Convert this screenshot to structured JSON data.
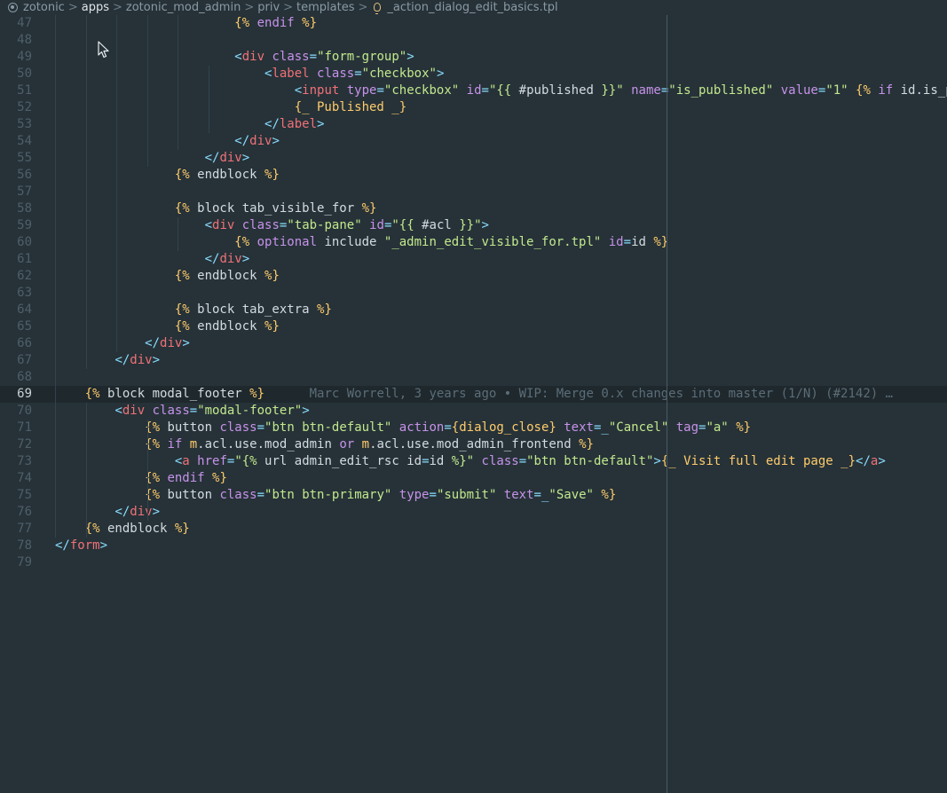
{
  "breadcrumb": {
    "items": [
      "zotonic",
      "apps",
      "zotonic_mod_admin",
      "priv",
      "templates",
      "_action_dialog_edit_basics.tpl"
    ],
    "active_index": 1,
    "separator": ">"
  },
  "editor": {
    "current_line": 69,
    "lines": [
      {
        "n": "47",
        "tokens": [
          [
            "                        ",
            "plain"
          ],
          [
            "{%",
            "delim"
          ],
          [
            " endif ",
            "kw"
          ],
          [
            "%}",
            "delim"
          ]
        ]
      },
      {
        "n": "48",
        "tokens": []
      },
      {
        "n": "49",
        "tokens": [
          [
            "                        ",
            "plain"
          ],
          [
            "<",
            "punc"
          ],
          [
            "div",
            "tag"
          ],
          [
            " ",
            "plain"
          ],
          [
            "class",
            "attr"
          ],
          [
            "=",
            "punc"
          ],
          [
            "\"form-group\"",
            "str"
          ],
          [
            ">",
            "punc"
          ]
        ]
      },
      {
        "n": "50",
        "tokens": [
          [
            "                            ",
            "plain"
          ],
          [
            "<",
            "punc"
          ],
          [
            "label",
            "tag"
          ],
          [
            " ",
            "plain"
          ],
          [
            "class",
            "attr"
          ],
          [
            "=",
            "punc"
          ],
          [
            "\"checkbox\"",
            "str"
          ],
          [
            ">",
            "punc"
          ]
        ]
      },
      {
        "n": "51",
        "tokens": [
          [
            "                                ",
            "plain"
          ],
          [
            "<",
            "punc"
          ],
          [
            "input",
            "tag"
          ],
          [
            " ",
            "plain"
          ],
          [
            "type",
            "attr"
          ],
          [
            "=",
            "punc"
          ],
          [
            "\"checkbox\"",
            "str"
          ],
          [
            " ",
            "plain"
          ],
          [
            "id",
            "attr"
          ],
          [
            "=",
            "punc"
          ],
          [
            "\"{{ ",
            "str"
          ],
          [
            "#published",
            "plain"
          ],
          [
            " }}\"",
            "str"
          ],
          [
            " ",
            "plain"
          ],
          [
            "name",
            "attr"
          ],
          [
            "=",
            "punc"
          ],
          [
            "\"is_published\"",
            "str"
          ],
          [
            " ",
            "plain"
          ],
          [
            "value",
            "attr"
          ],
          [
            "=",
            "punc"
          ],
          [
            "\"1\"",
            "str"
          ],
          [
            " ",
            "plain"
          ],
          [
            "{%",
            "delim"
          ],
          [
            " if ",
            "kw"
          ],
          [
            "id.is_pu",
            "plain"
          ]
        ]
      },
      {
        "n": "52",
        "tokens": [
          [
            "                                ",
            "plain"
          ],
          [
            "{_ Published _}",
            "trans"
          ]
        ]
      },
      {
        "n": "53",
        "tokens": [
          [
            "                            ",
            "plain"
          ],
          [
            "</",
            "punc"
          ],
          [
            "label",
            "tag"
          ],
          [
            ">",
            "punc"
          ]
        ]
      },
      {
        "n": "54",
        "tokens": [
          [
            "                        ",
            "plain"
          ],
          [
            "</",
            "punc"
          ],
          [
            "div",
            "tag"
          ],
          [
            ">",
            "punc"
          ]
        ]
      },
      {
        "n": "55",
        "tokens": [
          [
            "                    ",
            "plain"
          ],
          [
            "</",
            "punc"
          ],
          [
            "div",
            "tag"
          ],
          [
            ">",
            "punc"
          ]
        ]
      },
      {
        "n": "56",
        "tokens": [
          [
            "                ",
            "plain"
          ],
          [
            "{%",
            "delim"
          ],
          [
            " endblock ",
            "plain"
          ],
          [
            "%}",
            "delim"
          ]
        ]
      },
      {
        "n": "57",
        "tokens": []
      },
      {
        "n": "58",
        "tokens": [
          [
            "                ",
            "plain"
          ],
          [
            "{%",
            "delim"
          ],
          [
            " block tab_visible_for ",
            "plain"
          ],
          [
            "%}",
            "delim"
          ]
        ]
      },
      {
        "n": "59",
        "tokens": [
          [
            "                    ",
            "plain"
          ],
          [
            "<",
            "punc"
          ],
          [
            "div",
            "tag"
          ],
          [
            " ",
            "plain"
          ],
          [
            "class",
            "attr"
          ],
          [
            "=",
            "punc"
          ],
          [
            "\"tab-pane\"",
            "str"
          ],
          [
            " ",
            "plain"
          ],
          [
            "id",
            "attr"
          ],
          [
            "=",
            "punc"
          ],
          [
            "\"{{ ",
            "str"
          ],
          [
            "#acl",
            "plain"
          ],
          [
            " }}\"",
            "str"
          ],
          [
            ">",
            "punc"
          ]
        ]
      },
      {
        "n": "60",
        "tokens": [
          [
            "                        ",
            "plain"
          ],
          [
            "{%",
            "delim"
          ],
          [
            " optional ",
            "kw"
          ],
          [
            "include ",
            "plain"
          ],
          [
            "\"_admin_edit_visible_for.tpl\"",
            "str"
          ],
          [
            " id",
            "attr"
          ],
          [
            "=",
            "punc"
          ],
          [
            "id ",
            "plain"
          ],
          [
            "%}",
            "delim"
          ]
        ]
      },
      {
        "n": "61",
        "tokens": [
          [
            "                    ",
            "plain"
          ],
          [
            "</",
            "punc"
          ],
          [
            "div",
            "tag"
          ],
          [
            ">",
            "punc"
          ]
        ]
      },
      {
        "n": "62",
        "tokens": [
          [
            "                ",
            "plain"
          ],
          [
            "{%",
            "delim"
          ],
          [
            " endblock ",
            "plain"
          ],
          [
            "%}",
            "delim"
          ]
        ]
      },
      {
        "n": "63",
        "tokens": []
      },
      {
        "n": "64",
        "tokens": [
          [
            "                ",
            "plain"
          ],
          [
            "{%",
            "delim"
          ],
          [
            " block tab_extra ",
            "plain"
          ],
          [
            "%}",
            "delim"
          ]
        ]
      },
      {
        "n": "65",
        "tokens": [
          [
            "                ",
            "plain"
          ],
          [
            "{%",
            "delim"
          ],
          [
            " endblock ",
            "plain"
          ],
          [
            "%}",
            "delim"
          ]
        ]
      },
      {
        "n": "66",
        "tokens": [
          [
            "            ",
            "plain"
          ],
          [
            "</",
            "punc"
          ],
          [
            "div",
            "tag"
          ],
          [
            ">",
            "punc"
          ]
        ]
      },
      {
        "n": "67",
        "tokens": [
          [
            "        ",
            "plain"
          ],
          [
            "</",
            "punc"
          ],
          [
            "div",
            "tag"
          ],
          [
            ">",
            "punc"
          ]
        ]
      },
      {
        "n": "68",
        "tokens": []
      },
      {
        "n": "69",
        "tokens": [
          [
            "    ",
            "plain"
          ],
          [
            "{%",
            "delim"
          ],
          [
            " block modal_footer ",
            "plain"
          ],
          [
            "%}",
            "delim"
          ],
          [
            "      ",
            "plain"
          ],
          [
            "Marc Worrell, 3 years ago • WIP: Merge 0.x changes into master (1/N) (#2142) …",
            "blame"
          ]
        ]
      },
      {
        "n": "70",
        "tokens": [
          [
            "        ",
            "plain"
          ],
          [
            "<",
            "punc"
          ],
          [
            "div",
            "tag"
          ],
          [
            " ",
            "plain"
          ],
          [
            "class",
            "attr"
          ],
          [
            "=",
            "punc"
          ],
          [
            "\"modal-footer\"",
            "str"
          ],
          [
            ">",
            "punc"
          ]
        ]
      },
      {
        "n": "71",
        "tokens": [
          [
            "            ",
            "plain"
          ],
          [
            "{%",
            "delim"
          ],
          [
            " button ",
            "plain"
          ],
          [
            "class",
            "attr"
          ],
          [
            "=",
            "punc"
          ],
          [
            "\"btn btn-default\"",
            "str"
          ],
          [
            " action",
            "attr"
          ],
          [
            "=",
            "punc"
          ],
          [
            "{",
            "delim"
          ],
          [
            "dialog_close",
            "trans"
          ],
          [
            "}",
            "delim"
          ],
          [
            " text",
            "attr"
          ],
          [
            "=",
            "punc"
          ],
          [
            "_",
            "punc"
          ],
          [
            "\"Cancel\"",
            "str"
          ],
          [
            " tag",
            "attr"
          ],
          [
            "=",
            "punc"
          ],
          [
            "\"a\"",
            "str"
          ],
          [
            " ",
            "plain"
          ],
          [
            "%}",
            "delim"
          ]
        ]
      },
      {
        "n": "72",
        "tokens": [
          [
            "            ",
            "plain"
          ],
          [
            "{%",
            "delim"
          ],
          [
            " if ",
            "kw"
          ],
          [
            "m",
            "trans"
          ],
          [
            ".acl.use.mod_admin ",
            "plain"
          ],
          [
            "or ",
            "kw"
          ],
          [
            "m",
            "trans"
          ],
          [
            ".acl.use.mod_admin_frontend ",
            "plain"
          ],
          [
            "%}",
            "delim"
          ]
        ]
      },
      {
        "n": "73",
        "tokens": [
          [
            "                ",
            "plain"
          ],
          [
            "<",
            "punc"
          ],
          [
            "a",
            "tag"
          ],
          [
            " ",
            "plain"
          ],
          [
            "href",
            "attr"
          ],
          [
            "=",
            "punc"
          ],
          [
            "\"{% ",
            "str"
          ],
          [
            "url admin_edit_rsc id",
            "plain"
          ],
          [
            "=",
            "punc"
          ],
          [
            "id ",
            "plain"
          ],
          [
            "%}\"",
            "str"
          ],
          [
            " ",
            "plain"
          ],
          [
            "class",
            "attr"
          ],
          [
            "=",
            "punc"
          ],
          [
            "\"btn btn-default\"",
            "str"
          ],
          [
            ">",
            "punc"
          ],
          [
            "{_ Visit full edit page _}",
            "trans"
          ],
          [
            "</",
            "punc"
          ],
          [
            "a",
            "tag"
          ],
          [
            ">",
            "punc"
          ]
        ]
      },
      {
        "n": "74",
        "tokens": [
          [
            "            ",
            "plain"
          ],
          [
            "{%",
            "delim"
          ],
          [
            " endif ",
            "kw"
          ],
          [
            "%}",
            "delim"
          ]
        ]
      },
      {
        "n": "75",
        "tokens": [
          [
            "            ",
            "plain"
          ],
          [
            "{%",
            "delim"
          ],
          [
            " button ",
            "plain"
          ],
          [
            "class",
            "attr"
          ],
          [
            "=",
            "punc"
          ],
          [
            "\"btn btn-primary\"",
            "str"
          ],
          [
            " type",
            "attr"
          ],
          [
            "=",
            "punc"
          ],
          [
            "\"submit\"",
            "str"
          ],
          [
            " text",
            "attr"
          ],
          [
            "=",
            "punc"
          ],
          [
            "_",
            "punc"
          ],
          [
            "\"Save\"",
            "str"
          ],
          [
            " ",
            "plain"
          ],
          [
            "%}",
            "delim"
          ]
        ]
      },
      {
        "n": "76",
        "tokens": [
          [
            "        ",
            "plain"
          ],
          [
            "</",
            "punc"
          ],
          [
            "div",
            "tag"
          ],
          [
            ">",
            "punc"
          ]
        ]
      },
      {
        "n": "77",
        "tokens": [
          [
            "    ",
            "plain"
          ],
          [
            "{%",
            "delim"
          ],
          [
            " endblock ",
            "plain"
          ],
          [
            "%}",
            "delim"
          ]
        ]
      },
      {
        "n": "78",
        "tokens": [
          [
            "",
            "plain"
          ],
          [
            "</",
            "punc"
          ],
          [
            "form",
            "tag"
          ],
          [
            ">",
            "punc"
          ]
        ]
      },
      {
        "n": "79",
        "tokens": []
      }
    ]
  },
  "icons": {
    "repo": "repo-icon",
    "file": "lightbulb-icon",
    "pointer": "mouse-pointer-icon"
  },
  "theme": {
    "background": "#263238",
    "current_line": "#1e282d",
    "tag": "#f07178",
    "attribute": "#c792ea",
    "string": "#c3e88d",
    "template_delimiter": "#ffcb6b",
    "punctuation": "#89ddff"
  }
}
